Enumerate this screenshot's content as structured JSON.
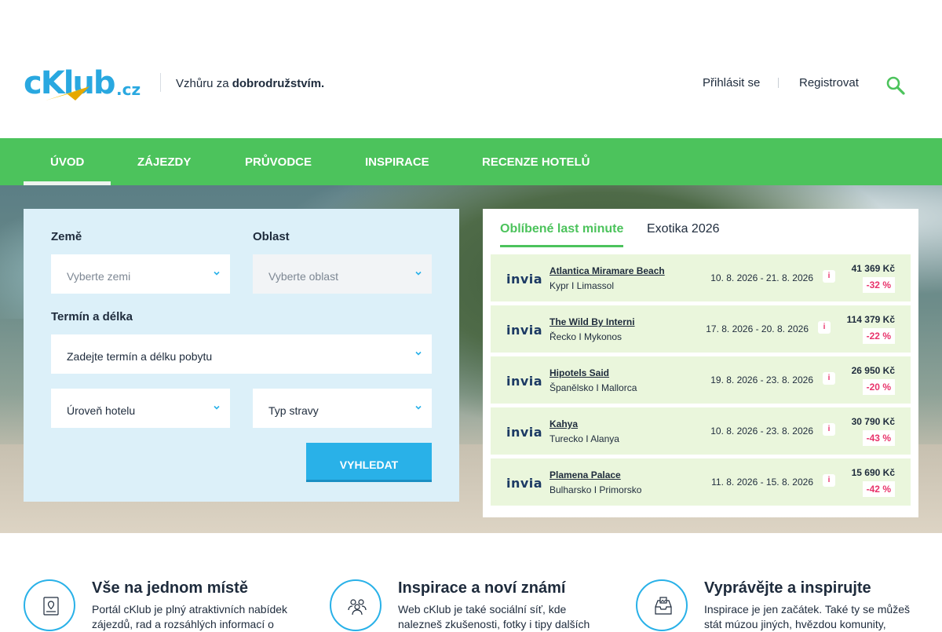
{
  "header": {
    "logo_text": "cKlub",
    "logo_tld": ".cz",
    "tagline_prefix": "Vzhůru za ",
    "tagline_bold": "dobrodružstvím.",
    "login": "Přihlásit se",
    "register": "Registrovat",
    "search_icon": "search-icon"
  },
  "nav": {
    "items": [
      "Úvod",
      "Zájezdy",
      "Průvodce",
      "Inspirace",
      "Recenze hotelů"
    ],
    "active": "Úvod"
  },
  "search_form": {
    "country_label": "Země",
    "country_placeholder": "Vyberte zemi",
    "region_label": "Oblast",
    "region_placeholder": "Vyberte oblast",
    "term_label": "Termín a délka",
    "term_placeholder": "Zadejte termín a délku pobytu",
    "hotel_level": "Úroveň hotelu",
    "board_type": "Typ stravy",
    "submit": "Vyhledat"
  },
  "deals": {
    "tabs": [
      "Oblíbené last minute",
      "Exotika 2026"
    ],
    "active_tab": "Oblíbené last minute",
    "info_symbol": "i",
    "rows": [
      {
        "brand": "invia",
        "name": "Atlantica Miramare Beach",
        "location": "Kypr I Limassol",
        "dates": "10. 8. 2026 - 21. 8. 2026",
        "price": "41 369 Kč",
        "discount": "-32 %"
      },
      {
        "brand": "invia",
        "name": "The Wild By Interni",
        "location": "Řecko I Mykonos",
        "dates": "17. 8. 2026 - 20. 8. 2026",
        "price": "114 379 Kč",
        "discount": "-22 %"
      },
      {
        "brand": "invia",
        "name": "Hipotels Said",
        "location": "Španělsko I Mallorca",
        "dates": "19. 8. 2026 - 23. 8. 2026",
        "price": "26 950 Kč",
        "discount": "-20 %"
      },
      {
        "brand": "invia",
        "name": "Kahya",
        "location": "Turecko I Alanya",
        "dates": "10. 8. 2026 - 23. 8. 2026",
        "price": "30 790 Kč",
        "discount": "-43 %"
      },
      {
        "brand": "invia",
        "name": "Plamena Palace",
        "location": "Bulharsko I Primorsko",
        "dates": "11. 8. 2026 - 15. 8. 2026",
        "price": "15 690 Kč",
        "discount": "-42 %"
      }
    ]
  },
  "features": [
    {
      "icon": "map-pin-icon",
      "title": "Vše na jednom místě",
      "text": "Portál cKlub je plný atraktivních nabídek zájezdů, rad a rozsáhlých informací o"
    },
    {
      "icon": "community-icon",
      "title": "Inspirace a noví známí",
      "text": "Web cKlub je také sociální síť, kde nalezneš zkušenosti, fotky i tipy dalších"
    },
    {
      "icon": "photo-inbox-icon",
      "title": "Vyprávějte a inspirujte",
      "text": "Inspirace je jen začátek. Také ty se můžeš stát múzou jiných, hvězdou komunity,"
    }
  ],
  "colors": {
    "nav_green": "#4cc35c",
    "brand_blue": "#29b1e8",
    "deal_bg": "#eaf6dc",
    "discount_red": "#e8336b",
    "form_bg": "#dcf0f9"
  }
}
